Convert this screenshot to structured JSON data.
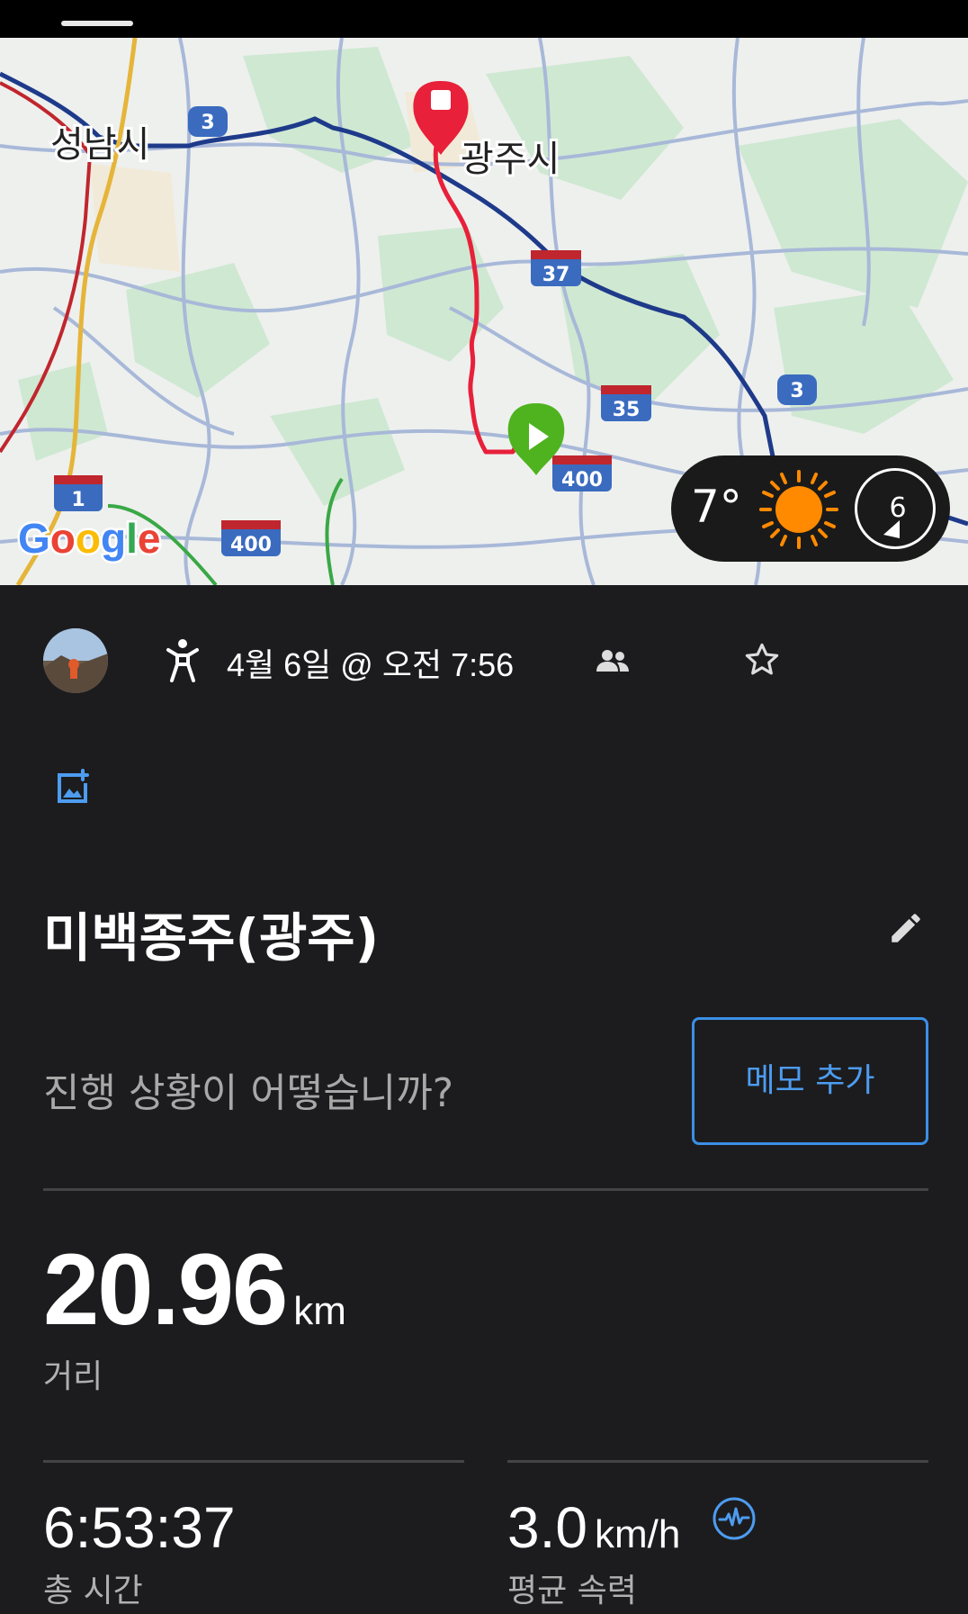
{
  "map": {
    "city_labels": [
      "성남시",
      "광주시"
    ],
    "road_shields": [
      "3",
      "37",
      "35",
      "3",
      "400",
      "1",
      "400"
    ],
    "logo": "Google"
  },
  "weather": {
    "temperature": "7°",
    "condition_icon": "sun-icon",
    "wind_speed": "6"
  },
  "activity": {
    "type_icon": "hiking-icon",
    "date": "4월 6일 @ 오전 7:56",
    "title": "미백종주(광주)",
    "prompt": "진행 상황이 어떻습니까?",
    "memo_button": "메모 추가"
  },
  "stats": {
    "distance": {
      "value": "20.96",
      "unit": "km",
      "label": "거리"
    },
    "total_time": {
      "value": "6:53:37",
      "label": "총 시간"
    },
    "avg_speed": {
      "value": "3.0",
      "unit": "km/h",
      "label": "평균 속력"
    }
  },
  "colors": {
    "accent": "#4d9cf0",
    "route": "#e8203a",
    "start_marker": "#4fb31f",
    "end_marker": "#e8203a",
    "background": "#1c1c1e"
  }
}
